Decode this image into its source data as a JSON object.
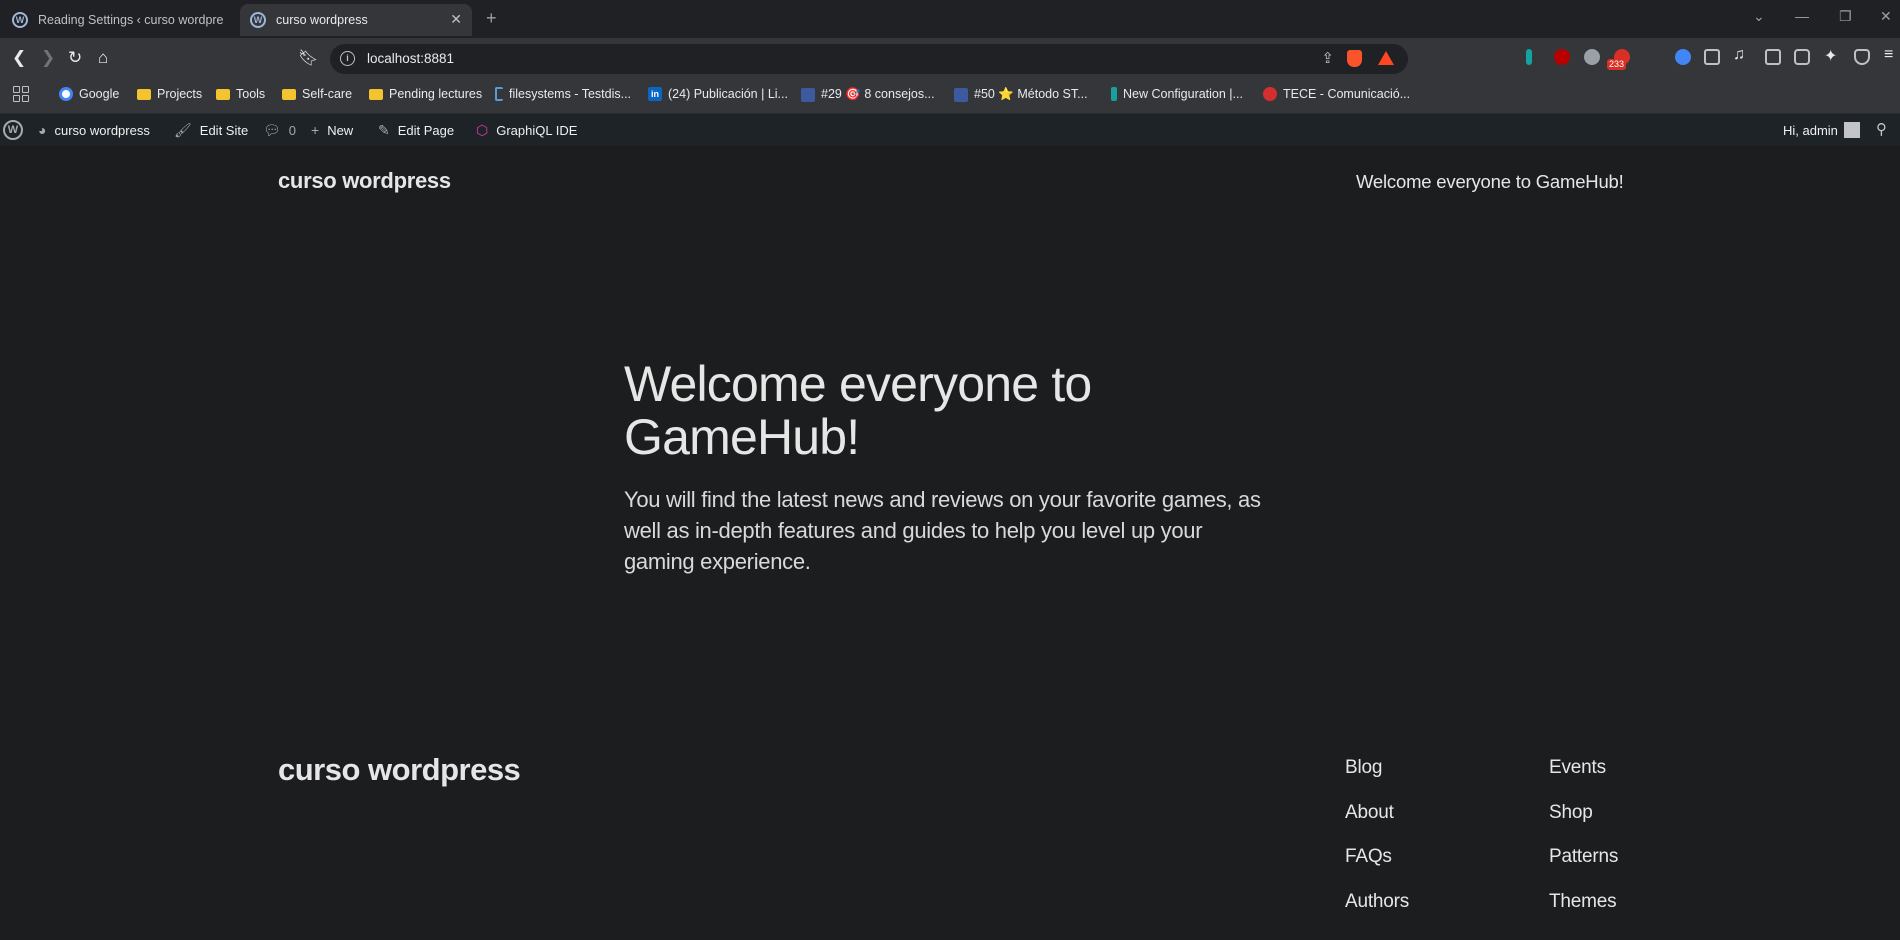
{
  "browser": {
    "tabs": [
      {
        "title": "Reading Settings ‹ curso wordpress",
        "active": false
      },
      {
        "title": "curso wordpress",
        "active": true
      }
    ],
    "address": "localhost:8881",
    "extension_badge": "233",
    "bookmarks": [
      {
        "label": "Google",
        "icon": "google-icon"
      },
      {
        "label": "Projects",
        "icon": "folder-icon"
      },
      {
        "label": "Tools",
        "icon": "folder-icon"
      },
      {
        "label": "Self-care",
        "icon": "folder-icon"
      },
      {
        "label": "Pending lectures",
        "icon": "folder-icon"
      },
      {
        "label": "filesystems - Testdis...",
        "icon": "bracket-icon"
      },
      {
        "label": "(24) Publicación | Li...",
        "icon": "linkedin-icon"
      },
      {
        "label": "#29 🎯 8 consejos...",
        "icon": "hmt-icon"
      },
      {
        "label": "#50 ⭐ Método ST...",
        "icon": "hmt-icon"
      },
      {
        "label": "New Configuration |...",
        "icon": "pin-icon"
      },
      {
        "label": "TECE - Comunicació...",
        "icon": "tece-icon"
      }
    ]
  },
  "adminbar": {
    "site_name": "curso wordpress",
    "edit_site": "Edit Site",
    "comments_count": "0",
    "new": "New",
    "edit_page": "Edit Page",
    "graphiql": "GraphiQL IDE",
    "greeting": "Hi, admin"
  },
  "site": {
    "title": "curso wordpress",
    "header_nav": "Welcome everyone to GameHub!",
    "hero_title": "Welcome everyone to GameHub!",
    "hero_text": "You will find the latest news and reviews on your favorite games, as well as in-depth features and guides to help you level up your gaming experience.",
    "footer_title": "curso wordpress",
    "footer_col1": [
      "Blog",
      "About",
      "FAQs",
      "Authors"
    ],
    "footer_col2": [
      "Events",
      "Shop",
      "Patterns",
      "Themes"
    ]
  },
  "colors": {
    "background": "#1c1d1f",
    "text": "#e6e6e6",
    "adminbar": "#1d2327",
    "graphiql": "#e535ab"
  }
}
